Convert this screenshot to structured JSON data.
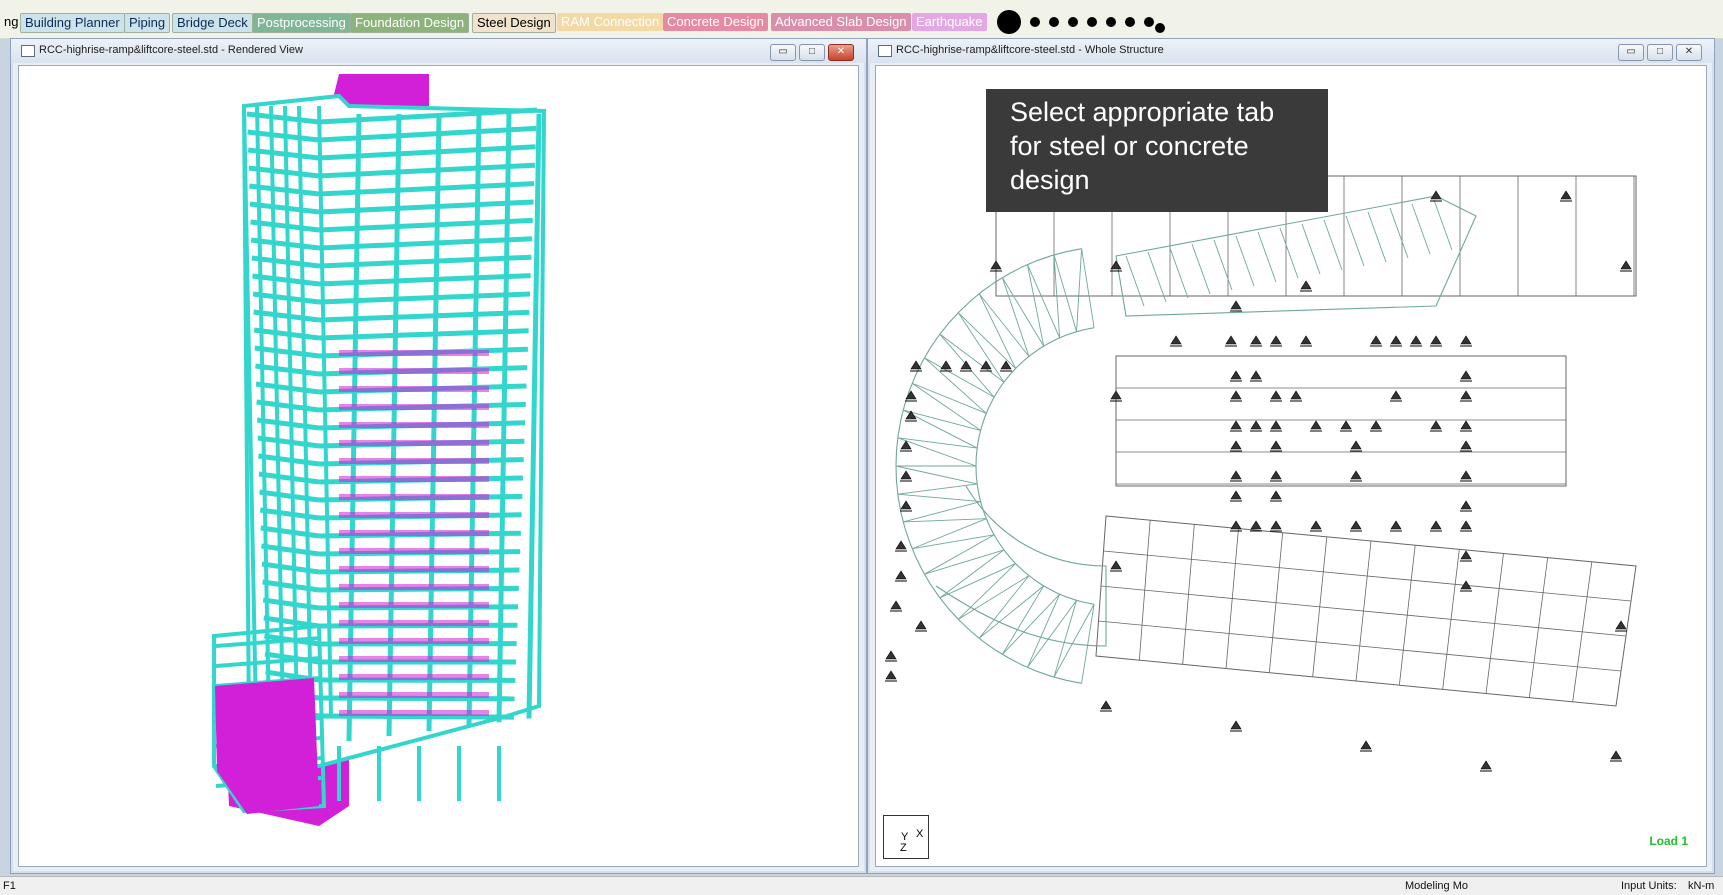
{
  "tabs": [
    {
      "label": "ng",
      "color": "#000000",
      "bg": "transparent",
      "bordered": false
    },
    {
      "label": "Building Planner",
      "color": "#0b2b55",
      "bg": "#cde3ea",
      "bordered": true
    },
    {
      "label": "Piping",
      "color": "#0b2b55",
      "bg": "#cde3ea",
      "bordered": true
    },
    {
      "label": "Bridge Deck",
      "color": "#0b2b55",
      "bg": "#cde3ea",
      "bordered": true
    },
    {
      "label": "Postprocessing",
      "color": "#ffffff",
      "bg": "#7fb695",
      "bordered": true
    },
    {
      "label": "Foundation Design",
      "color": "#ffffff",
      "bg": "#8cb47a",
      "bordered": true
    },
    {
      "label": "Steel Design",
      "color": "#000000",
      "bg": "#f2e4cc",
      "bordered": true
    },
    {
      "label": "RAM Connection",
      "color": "#ffffff",
      "bg": "#f3d9a6",
      "bordered": false
    },
    {
      "label": "Concrete Design",
      "color": "#ffffff",
      "bg": "#e58aa2",
      "bordered": false
    },
    {
      "label": "Advanced Slab Design",
      "color": "#ffffff",
      "bg": "#d98eaa",
      "bordered": false
    },
    {
      "label": "Earthquake",
      "color": "#ffffff",
      "bg": "#e3a8e3",
      "bordered": false
    }
  ],
  "left_window": {
    "title": "RCC-highrise-ramp&liftcore-steel.std - Rendered View",
    "min_glyph": "▭",
    "max_glyph": "□",
    "close_glyph": "✕"
  },
  "right_window": {
    "title": "RCC-highrise-ramp&liftcore-steel.std - Whole Structure",
    "min_glyph": "▭",
    "max_glyph": "□",
    "close_glyph": "✕",
    "load_label": "Load 1",
    "axis_labels": {
      "y": "Y",
      "x": "X",
      "z": "Z"
    }
  },
  "tooltip": {
    "line1": "Select appropriate tab",
    "line2": "for steel or concrete",
    "line3": "design"
  },
  "statusbar": {
    "left": "F1",
    "mode": "Modeling Mo",
    "units_label": "Input Units:",
    "units_value": "kN-m"
  },
  "colors": {
    "frame": "#33d6cc",
    "frame_dark": "#1ea39b",
    "core": "#d21fd8",
    "mesh": "#6fa79a",
    "grid": "#666666"
  }
}
